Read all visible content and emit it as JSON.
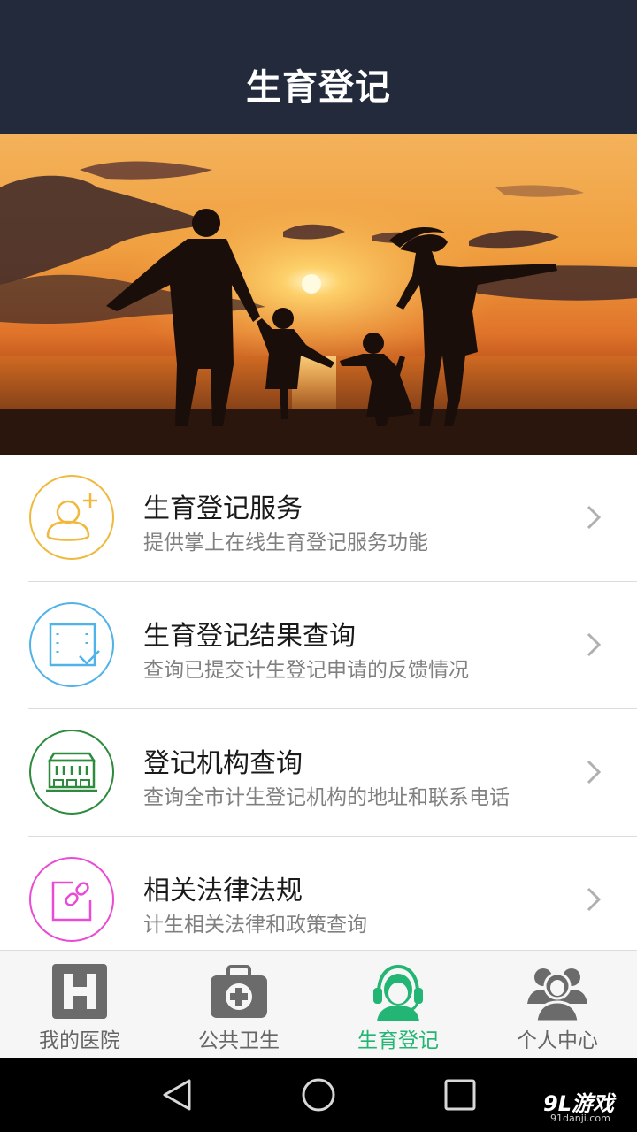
{
  "header": {
    "title": "生育登记"
  },
  "banner": {
    "image": "family-silhouette-sunset"
  },
  "menu": {
    "items": [
      {
        "title": "生育登记服务",
        "subtitle": "提供掌上在线生育登记服务功能",
        "icon": "add-user-icon",
        "color": "#f0b93d"
      },
      {
        "title": "生育登记结果查询",
        "subtitle": "查询已提交计生登记申请的反馈情况",
        "icon": "document-check-icon",
        "color": "#4fb3e8"
      },
      {
        "title": "登记机构查询",
        "subtitle": "查询全市计生登记机构的地址和联系电话",
        "icon": "building-icon",
        "color": "#2e8b3e"
      },
      {
        "title": "相关法律法规",
        "subtitle": "计生相关法律和政策查询",
        "icon": "link-edit-icon",
        "color": "#e94bd5"
      }
    ]
  },
  "tabbar": {
    "active_color": "#22b573",
    "tabs": [
      {
        "label": "我的医院",
        "icon": "hospital-icon",
        "active": false
      },
      {
        "label": "公共卫生",
        "icon": "medical-kit-icon",
        "active": false
      },
      {
        "label": "生育登记",
        "icon": "headset-nurse-icon",
        "active": true
      },
      {
        "label": "个人中心",
        "icon": "users-icon",
        "active": false
      }
    ]
  },
  "navbar": {
    "buttons": [
      "back-icon",
      "home-icon",
      "recents-icon"
    ]
  },
  "watermark": {
    "logo": "9L游戏",
    "url": "91danji.com"
  }
}
